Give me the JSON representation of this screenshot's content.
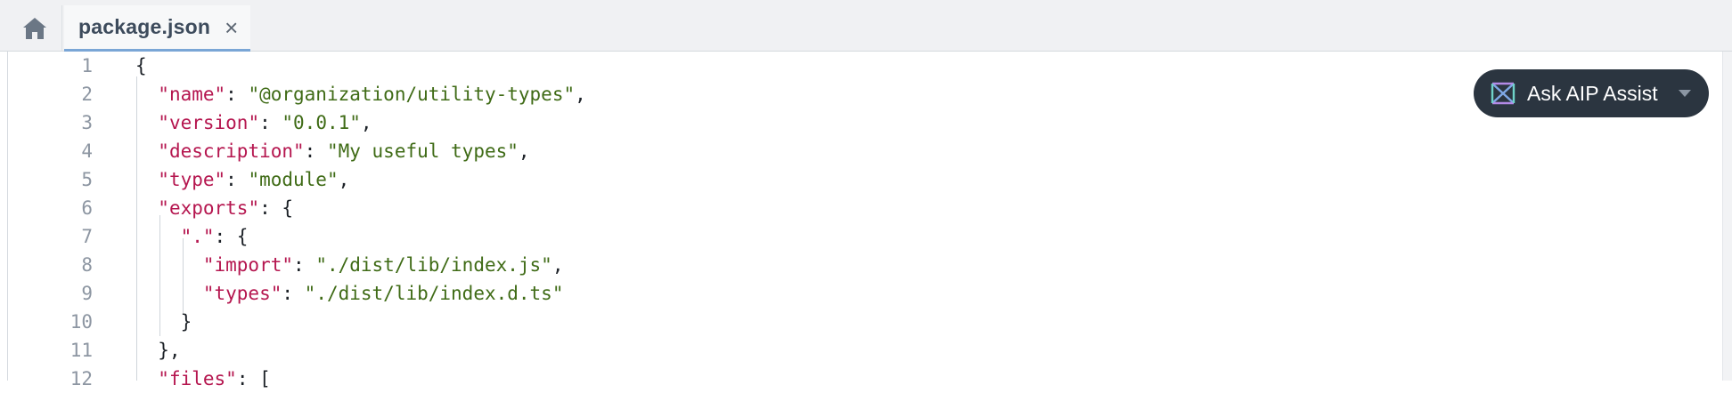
{
  "tabbar": {
    "home_icon": "home-icon",
    "tabs": [
      {
        "label": "package.json",
        "close": "×"
      }
    ]
  },
  "assist": {
    "label": "Ask AIP Assist",
    "icon": "aip-logo-icon",
    "caret_icon": "caret-down-icon"
  },
  "colors": {
    "key": "#b5164f",
    "string": "#3f6b16",
    "punctuation": "#1c2127",
    "line_number": "#8d96a2",
    "active_tab_underline": "#7aa6d6",
    "assist_bg": "#2b3540"
  },
  "editor": {
    "lines": [
      {
        "n": "1",
        "parts": [
          {
            "t": "p",
            "v": "{"
          }
        ]
      },
      {
        "n": "2",
        "parts": [
          {
            "t": "p",
            "v": "  "
          },
          {
            "t": "k",
            "v": "\"name\""
          },
          {
            "t": "p",
            "v": ": "
          },
          {
            "t": "s",
            "v": "\"@organization/utility-types\""
          },
          {
            "t": "p",
            "v": ","
          }
        ]
      },
      {
        "n": "3",
        "parts": [
          {
            "t": "p",
            "v": "  "
          },
          {
            "t": "k",
            "v": "\"version\""
          },
          {
            "t": "p",
            "v": ": "
          },
          {
            "t": "s",
            "v": "\"0.0.1\""
          },
          {
            "t": "p",
            "v": ","
          }
        ]
      },
      {
        "n": "4",
        "parts": [
          {
            "t": "p",
            "v": "  "
          },
          {
            "t": "k",
            "v": "\"description\""
          },
          {
            "t": "p",
            "v": ": "
          },
          {
            "t": "s",
            "v": "\"My useful types\""
          },
          {
            "t": "p",
            "v": ","
          }
        ]
      },
      {
        "n": "5",
        "parts": [
          {
            "t": "p",
            "v": "  "
          },
          {
            "t": "k",
            "v": "\"type\""
          },
          {
            "t": "p",
            "v": ": "
          },
          {
            "t": "s",
            "v": "\"module\""
          },
          {
            "t": "p",
            "v": ","
          }
        ]
      },
      {
        "n": "6",
        "parts": [
          {
            "t": "p",
            "v": "  "
          },
          {
            "t": "k",
            "v": "\"exports\""
          },
          {
            "t": "p",
            "v": ": {"
          }
        ]
      },
      {
        "n": "7",
        "parts": [
          {
            "t": "p",
            "v": "    "
          },
          {
            "t": "k",
            "v": "\".\""
          },
          {
            "t": "p",
            "v": ": {"
          }
        ]
      },
      {
        "n": "8",
        "parts": [
          {
            "t": "p",
            "v": "      "
          },
          {
            "t": "k",
            "v": "\"import\""
          },
          {
            "t": "p",
            "v": ": "
          },
          {
            "t": "s",
            "v": "\"./dist/lib/index.js\""
          },
          {
            "t": "p",
            "v": ","
          }
        ]
      },
      {
        "n": "9",
        "parts": [
          {
            "t": "p",
            "v": "      "
          },
          {
            "t": "k",
            "v": "\"types\""
          },
          {
            "t": "p",
            "v": ": "
          },
          {
            "t": "s",
            "v": "\"./dist/lib/index.d.ts\""
          }
        ]
      },
      {
        "n": "10",
        "parts": [
          {
            "t": "p",
            "v": "    }"
          }
        ]
      },
      {
        "n": "11",
        "parts": [
          {
            "t": "p",
            "v": "  },"
          }
        ]
      },
      {
        "n": "12",
        "parts": [
          {
            "t": "p",
            "v": "  "
          },
          {
            "t": "k",
            "v": "\"files\""
          },
          {
            "t": "p",
            "v": ": ["
          }
        ]
      }
    ]
  }
}
